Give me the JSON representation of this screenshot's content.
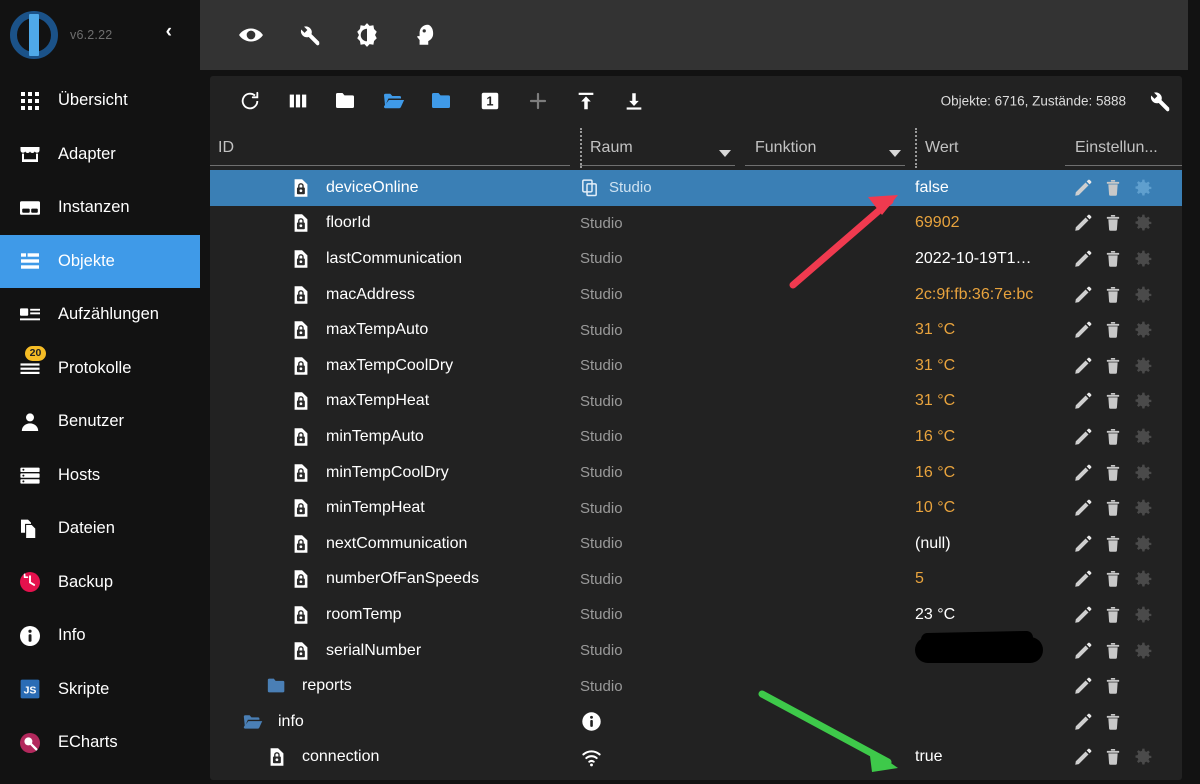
{
  "app": {
    "version": "v6.2.22",
    "collapse_label": "‹",
    "logo_name": "iobroker-logo"
  },
  "sidebar": {
    "items": [
      {
        "label": "Übersicht",
        "icon": "grid-icon",
        "active": false,
        "badge": null
      },
      {
        "label": "Adapter",
        "icon": "store-icon",
        "active": false,
        "badge": null
      },
      {
        "label": "Instanzen",
        "icon": "instances-icon",
        "active": false,
        "badge": null
      },
      {
        "label": "Objekte",
        "icon": "list-icon",
        "active": true,
        "badge": null
      },
      {
        "label": "Aufzählungen",
        "icon": "enums-icon",
        "active": false,
        "badge": null
      },
      {
        "label": "Protokolle",
        "icon": "logs-icon",
        "active": false,
        "badge": "20"
      },
      {
        "label": "Benutzer",
        "icon": "user-icon",
        "active": false,
        "badge": null
      },
      {
        "label": "Hosts",
        "icon": "hosts-icon",
        "active": false,
        "badge": null
      },
      {
        "label": "Dateien",
        "icon": "files-icon",
        "active": false,
        "badge": null
      },
      {
        "label": "Backup",
        "icon": "backup-clock-icon",
        "active": false,
        "badge": null
      },
      {
        "label": "Info",
        "icon": "info-icon",
        "active": false,
        "badge": null
      },
      {
        "label": "Skripte",
        "icon": "javascript-icon",
        "active": false,
        "badge": null
      },
      {
        "label": "ECharts",
        "icon": "echarts-icon",
        "active": false,
        "badge": null
      }
    ]
  },
  "topbar": {
    "icons": [
      {
        "name": "eye-icon",
        "title": "Sichtbarkeit"
      },
      {
        "name": "wrench-icon",
        "title": "Experte"
      },
      {
        "name": "brightness-icon",
        "title": "Theme"
      },
      {
        "name": "head-icon",
        "title": "Benutzer"
      }
    ]
  },
  "objects_toolbar": {
    "icons": [
      {
        "name": "refresh-icon"
      },
      {
        "name": "columns-icon"
      },
      {
        "name": "collapse-all-folders-icon"
      },
      {
        "name": "expand-all-folders-icon"
      },
      {
        "name": "folder-icon"
      },
      {
        "name": "depth-1-icon",
        "label": "1"
      },
      {
        "name": "add-object-icon"
      },
      {
        "name": "import-icon"
      },
      {
        "name": "export-icon"
      }
    ],
    "counts_text": "Objekte: 6716, Zustände: 5888",
    "settings_icon": "wrench-icon"
  },
  "table": {
    "headers": [
      {
        "label": "ID",
        "name": "column-header-id",
        "dropdown": false,
        "underline": true
      },
      {
        "label": "Raum",
        "name": "column-header-room",
        "dropdown": true,
        "underline": true
      },
      {
        "label": "Funktion",
        "name": "column-header-function",
        "dropdown": true,
        "underline": true
      },
      {
        "label": "Wert",
        "name": "column-header-value",
        "dropdown": false,
        "underline": false
      },
      {
        "label": "Einstellun...",
        "name": "column-header-settings",
        "dropdown": true,
        "underline": true
      }
    ],
    "rows": [
      {
        "id": "deviceOnline",
        "icon": "state-lock-icon",
        "indent": 3,
        "room": "Studio",
        "room_icon": "copy-icon",
        "value": "false",
        "value_type": "string",
        "selected": true,
        "actions": [
          "edit-icon",
          "delete-icon",
          "settings-icon"
        ]
      },
      {
        "id": "floorId",
        "icon": "state-lock-icon",
        "indent": 3,
        "room": "Studio",
        "room_icon": null,
        "value": "69902",
        "value_type": "number",
        "selected": false,
        "actions": [
          "edit-icon",
          "delete-icon",
          "settings-icon"
        ]
      },
      {
        "id": "lastCommunication",
        "icon": "state-lock-icon",
        "indent": 3,
        "room": "Studio",
        "room_icon": null,
        "value": "2022-10-19T1…",
        "value_type": "string",
        "selected": false,
        "actions": [
          "edit-icon",
          "delete-icon",
          "settings-icon"
        ]
      },
      {
        "id": "macAddress",
        "icon": "state-lock-icon",
        "indent": 3,
        "room": "Studio",
        "room_icon": null,
        "value": "2c:9f:fb:36:7e:bc",
        "value_type": "number",
        "selected": false,
        "actions": [
          "edit-icon",
          "delete-icon",
          "settings-icon"
        ]
      },
      {
        "id": "maxTempAuto",
        "icon": "state-lock-icon",
        "indent": 3,
        "room": "Studio",
        "room_icon": null,
        "value": "31 °C",
        "value_type": "number",
        "selected": false,
        "actions": [
          "edit-icon",
          "delete-icon",
          "settings-icon"
        ]
      },
      {
        "id": "maxTempCoolDry",
        "icon": "state-lock-icon",
        "indent": 3,
        "room": "Studio",
        "room_icon": null,
        "value": "31 °C",
        "value_type": "number",
        "selected": false,
        "actions": [
          "edit-icon",
          "delete-icon",
          "settings-icon"
        ]
      },
      {
        "id": "maxTempHeat",
        "icon": "state-lock-icon",
        "indent": 3,
        "room": "Studio",
        "room_icon": null,
        "value": "31 °C",
        "value_type": "number",
        "selected": false,
        "actions": [
          "edit-icon",
          "delete-icon",
          "settings-icon"
        ]
      },
      {
        "id": "minTempAuto",
        "icon": "state-lock-icon",
        "indent": 3,
        "room": "Studio",
        "room_icon": null,
        "value": "16 °C",
        "value_type": "number",
        "selected": false,
        "actions": [
          "edit-icon",
          "delete-icon",
          "settings-icon"
        ]
      },
      {
        "id": "minTempCoolDry",
        "icon": "state-lock-icon",
        "indent": 3,
        "room": "Studio",
        "room_icon": null,
        "value": "16 °C",
        "value_type": "number",
        "selected": false,
        "actions": [
          "edit-icon",
          "delete-icon",
          "settings-icon"
        ]
      },
      {
        "id": "minTempHeat",
        "icon": "state-lock-icon",
        "indent": 3,
        "room": "Studio",
        "room_icon": null,
        "value": "10 °C",
        "value_type": "number",
        "selected": false,
        "actions": [
          "edit-icon",
          "delete-icon",
          "settings-icon"
        ]
      },
      {
        "id": "nextCommunication",
        "icon": "state-lock-icon",
        "indent": 3,
        "room": "Studio",
        "room_icon": null,
        "value": "(null)",
        "value_type": "string",
        "selected": false,
        "actions": [
          "edit-icon",
          "delete-icon",
          "settings-icon"
        ]
      },
      {
        "id": "numberOfFanSpeeds",
        "icon": "state-lock-icon",
        "indent": 3,
        "room": "Studio",
        "room_icon": null,
        "value": "5",
        "value_type": "number",
        "selected": false,
        "actions": [
          "edit-icon",
          "delete-icon",
          "settings-icon"
        ]
      },
      {
        "id": "roomTemp",
        "icon": "state-lock-icon",
        "indent": 3,
        "room": "Studio",
        "room_icon": null,
        "value": "23 °C",
        "value_type": "string",
        "selected": false,
        "actions": [
          "edit-icon",
          "delete-icon",
          "settings-icon"
        ]
      },
      {
        "id": "serialNumber",
        "icon": "state-lock-icon",
        "indent": 3,
        "room": "Studio",
        "room_icon": null,
        "value": "",
        "value_type": "redacted",
        "selected": false,
        "actions": [
          "edit-icon",
          "delete-icon",
          "settings-icon"
        ]
      },
      {
        "id": "reports",
        "icon": "folder-icon",
        "indent": 2,
        "room": "Studio",
        "room_icon": null,
        "value": "",
        "value_type": "none",
        "selected": false,
        "actions": [
          "edit-icon",
          "delete-icon"
        ]
      },
      {
        "id": "info",
        "icon": "folder-open-icon",
        "indent": 1,
        "room": "",
        "room_icon": "info-circle-icon",
        "value": "",
        "value_type": "none",
        "selected": false,
        "actions": [
          "edit-icon",
          "delete-icon"
        ]
      },
      {
        "id": "connection",
        "icon": "state-lock-icon",
        "indent": 2,
        "room": "",
        "room_icon": "wifi-icon",
        "value": "true",
        "value_type": "string",
        "selected": false,
        "actions": [
          "edit-icon",
          "delete-icon",
          "settings-icon"
        ]
      }
    ]
  },
  "annotations": [
    {
      "name": "red-arrow-annotation",
      "color": "#f03a4f",
      "points_to": "deviceOnline value false"
    },
    {
      "name": "green-arrow-annotation",
      "color": "#3ec94a",
      "points_to": "connection value true"
    }
  ],
  "colors": {
    "accent_blue": "#3f9ae8",
    "selected_row": "#3a7fb5",
    "value_number": "#e8a33d",
    "panel_bg": "#222222",
    "topbar_bg": "#333333",
    "sidebar_bg": "#121212",
    "badge_yellow": "#f5bc25"
  }
}
